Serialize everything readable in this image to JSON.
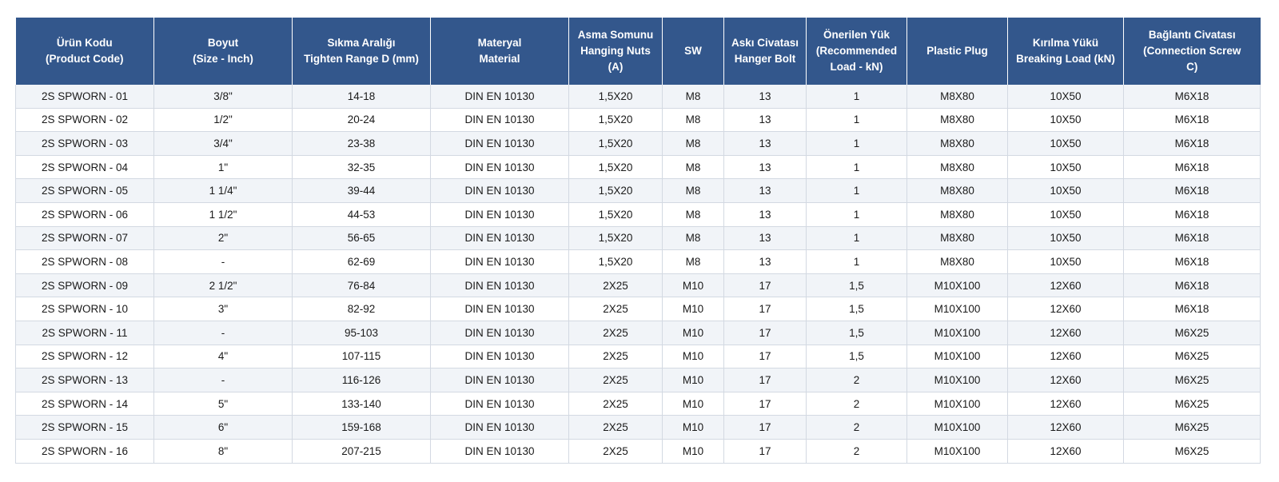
{
  "table": {
    "columns": [
      "Ürün Kodu\n(Product Code)",
      "Boyut\n(Size - Inch)",
      "Sıkma Aralığı\nTighten Range D (mm)",
      "Materyal\nMaterial",
      "Asma Somunu\nHanging Nuts\n(A)",
      "SW",
      "Askı Civatası\nHanger Bolt",
      "Önerilen Yük\n(Recommended\nLoad - kN)",
      "Plastic Plug",
      "Kırılma Yükü\nBreaking Load (kN)",
      "Bağlantı Civatası\n(Connection Screw\nC)"
    ],
    "rows": [
      [
        "2S SPWORN - 01",
        "3/8\"",
        "14-18",
        "DIN EN 10130",
        "1,5X20",
        "M8",
        "13",
        "1",
        "M8X80",
        "10X50",
        "M6X18"
      ],
      [
        "2S SPWORN - 02",
        "1/2\"",
        "20-24",
        "DIN EN 10130",
        "1,5X20",
        "M8",
        "13",
        "1",
        "M8X80",
        "10X50",
        "M6X18"
      ],
      [
        "2S SPWORN - 03",
        "3/4\"",
        "23-38",
        "DIN EN 10130",
        "1,5X20",
        "M8",
        "13",
        "1",
        "M8X80",
        "10X50",
        "M6X18"
      ],
      [
        "2S SPWORN - 04",
        "1\"",
        "32-35",
        "DIN EN 10130",
        "1,5X20",
        "M8",
        "13",
        "1",
        "M8X80",
        "10X50",
        "M6X18"
      ],
      [
        "2S SPWORN - 05",
        "1 1/4\"",
        "39-44",
        "DIN EN 10130",
        "1,5X20",
        "M8",
        "13",
        "1",
        "M8X80",
        "10X50",
        "M6X18"
      ],
      [
        "2S SPWORN - 06",
        "1 1/2\"",
        "44-53",
        "DIN EN 10130",
        "1,5X20",
        "M8",
        "13",
        "1",
        "M8X80",
        "10X50",
        "M6X18"
      ],
      [
        "2S SPWORN - 07",
        "2\"",
        "56-65",
        "DIN EN 10130",
        "1,5X20",
        "M8",
        "13",
        "1",
        "M8X80",
        "10X50",
        "M6X18"
      ],
      [
        "2S SPWORN - 08",
        "-",
        "62-69",
        "DIN EN 10130",
        "1,5X20",
        "M8",
        "13",
        "1",
        "M8X80",
        "10X50",
        "M6X18"
      ],
      [
        "2S SPWORN - 09",
        "2 1/2\"",
        "76-84",
        "DIN EN 10130",
        "2X25",
        "M10",
        "17",
        "1,5",
        "M10X100",
        "12X60",
        "M6X18"
      ],
      [
        "2S SPWORN - 10",
        "3\"",
        "82-92",
        "DIN EN 10130",
        "2X25",
        "M10",
        "17",
        "1,5",
        "M10X100",
        "12X60",
        "M6X18"
      ],
      [
        "2S SPWORN - 11",
        "-",
        "95-103",
        "DIN EN 10130",
        "2X25",
        "M10",
        "17",
        "1,5",
        "M10X100",
        "12X60",
        "M6X25"
      ],
      [
        "2S SPWORN - 12",
        "4\"",
        "107-115",
        "DIN EN 10130",
        "2X25",
        "M10",
        "17",
        "1,5",
        "M10X100",
        "12X60",
        "M6X25"
      ],
      [
        "2S SPWORN - 13",
        "-",
        "116-126",
        "DIN EN 10130",
        "2X25",
        "M10",
        "17",
        "2",
        "M10X100",
        "12X60",
        "M6X25"
      ],
      [
        "2S SPWORN - 14",
        "5\"",
        "133-140",
        "DIN EN 10130",
        "2X25",
        "M10",
        "17",
        "2",
        "M10X100",
        "12X60",
        "M6X25"
      ],
      [
        "2S SPWORN - 15",
        "6\"",
        "159-168",
        "DIN EN 10130",
        "2X25",
        "M10",
        "17",
        "2",
        "M10X100",
        "12X60",
        "M6X25"
      ],
      [
        "2S SPWORN - 16",
        "8\"",
        "207-215",
        "DIN EN 10130",
        "2X25",
        "M10",
        "17",
        "2",
        "M10X100",
        "12X60",
        "M6X25"
      ]
    ]
  },
  "colors": {
    "header_bg": "#33578c",
    "header_text": "#ffffff",
    "row_alt_bg": "#f1f4f8",
    "row_bg": "#ffffff",
    "grid": "#d3d9e2"
  }
}
